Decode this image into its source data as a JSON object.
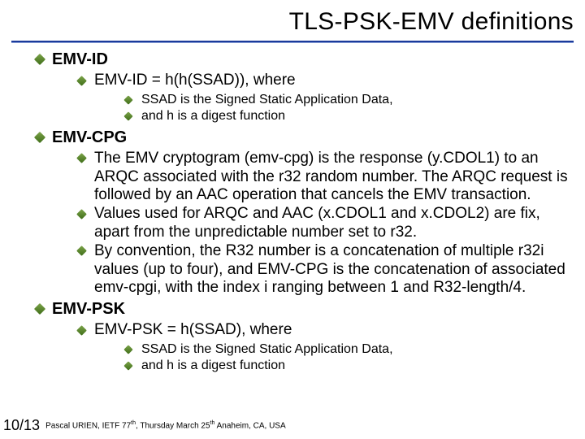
{
  "title": "TLS-PSK-EMV definitions",
  "sections": {
    "emvid": {
      "heading": "EMV-ID",
      "def": "EMV-ID = h(h(SSAD)), where",
      "sub1": "SSAD is the Signed Static Application Data,",
      "sub2": "and h is a digest function"
    },
    "emvcpg": {
      "heading": "EMV-CPG",
      "p1": "The EMV cryptogram (emv-cpg) is the response (y.CDOL1) to an ARQC associated with the r32 random number. The ARQC request is followed by an AAC operation that cancels the EMV transaction.",
      "p2": "Values used for ARQC and AAC (x.CDOL1 and x.CDOL2) are fix, apart from the unpredictable number set to r32.",
      "p3": "By convention, the R32 number is a concatenation of multiple r32i values (up to four), and EMV-CPG is the concatenation of associated emv-cpgi, with the index i ranging between 1 and R32-length/4."
    },
    "emvpsk": {
      "heading": "EMV-PSK",
      "def": "EMV-PSK = h(SSAD), where",
      "sub1": "SSAD is the Signed Static Application Data,",
      "sub2": "and h is a digest function"
    }
  },
  "footer": {
    "page": "10",
    "totalSep": "/",
    "total": "13",
    "cite_pre": "Pascal URIEN, IETF 77",
    "cite_sup1": "th",
    "cite_mid": ", Thursday March  25",
    "cite_sup2": "th",
    "cite_post": " Anaheim, CA, USA"
  }
}
